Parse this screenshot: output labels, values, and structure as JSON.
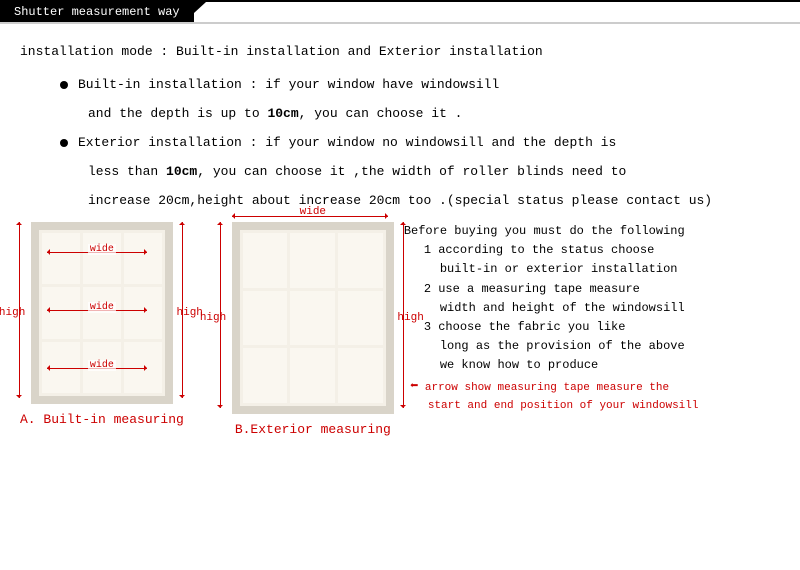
{
  "header": {
    "title": "Shutter measurement way"
  },
  "intro": {
    "mode_line": "installation mode : Built-in installation and Exterior installation",
    "bullet1_line1": "Built-in installation : if your window have windowsill",
    "bullet1_line2a": "and the depth is up to ",
    "bullet1_line2_bold": "10cm",
    "bullet1_line2b": ", you can choose it .",
    "bullet2_line1": "Exterior installation : if your window no windowsill and the depth is",
    "bullet2_line2a": "less than ",
    "bullet2_line2_bold": "10cm",
    "bullet2_line2b": ", you can choose it ,the width of roller blinds need to",
    "bullet2_line3": "increase 20cm,height about increase 20cm too .(special status please contact us)"
  },
  "diagrams": {
    "wide": "wide",
    "high": "high",
    "captionA": "A. Built-in measuring",
    "captionB": "B.Exterior measuring"
  },
  "steps": {
    "before": "Before buying you must do the following",
    "s1a": "1 according to the status choose",
    "s1b": "built-in or exterior installation",
    "s2a": "2 use a measuring tape measure",
    "s2b": "width and height of the windowsill",
    "s3a": "3 choose the fabric you like",
    "s3b": "long as the provision of the above",
    "s3c": "we know how to produce",
    "arrow_note1": "arrow show measuring tape measure the",
    "arrow_note2": "start and end position of your windowsill"
  }
}
